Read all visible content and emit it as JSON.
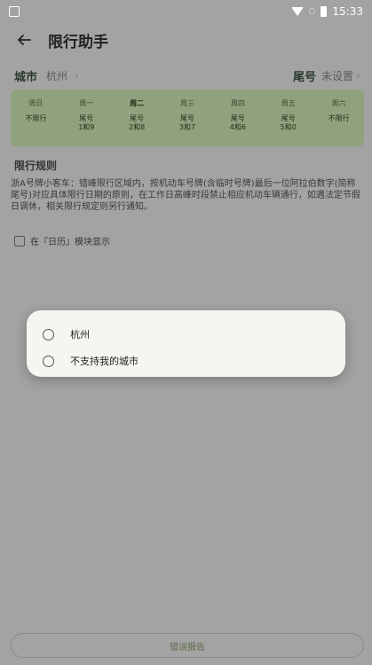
{
  "status_bar": {
    "time": "15:33"
  },
  "app_bar": {
    "title": "限行助手"
  },
  "city_row": {
    "city_label": "城市",
    "city_value": "杭州",
    "tail_label": "尾号",
    "tail_value": "未设置"
  },
  "week": {
    "days": [
      {
        "name": "周日",
        "rule": "不限行"
      },
      {
        "name": "周一",
        "rule": "尾号\n1和9"
      },
      {
        "name": "周二",
        "rule": "尾号\n2和8"
      },
      {
        "name": "周三",
        "rule": "尾号\n3和7"
      },
      {
        "name": "周四",
        "rule": "尾号\n4和6"
      },
      {
        "name": "周五",
        "rule": "尾号\n5和0"
      },
      {
        "name": "周六",
        "rule": "不限行"
      }
    ]
  },
  "rules": {
    "title": "限行规则",
    "text": "浙A号牌小客车：错峰限行区域内，按机动车号牌(含临时号牌)最后一位阿拉伯数字(简称尾号)对应具体限行日期的原则，在工作日高峰时段禁止相应机动车辆通行，如遇法定节假日调休，相关限行规定则另行通知。"
  },
  "checkbox": {
    "label": "在『日历』模块显示"
  },
  "dialog": {
    "options": [
      {
        "label": "杭州"
      },
      {
        "label": "不支持我的城市"
      }
    ]
  },
  "report_button": {
    "label": "错误报告"
  },
  "colors": {
    "background_dim": "#a3a3a3",
    "card": "#8fa27d",
    "dialog": "#f4f7ef",
    "accent_text": "#5d6b4d"
  },
  "icons": {
    "back": "arrow-left-icon",
    "chevron": "chevron-right-icon"
  }
}
